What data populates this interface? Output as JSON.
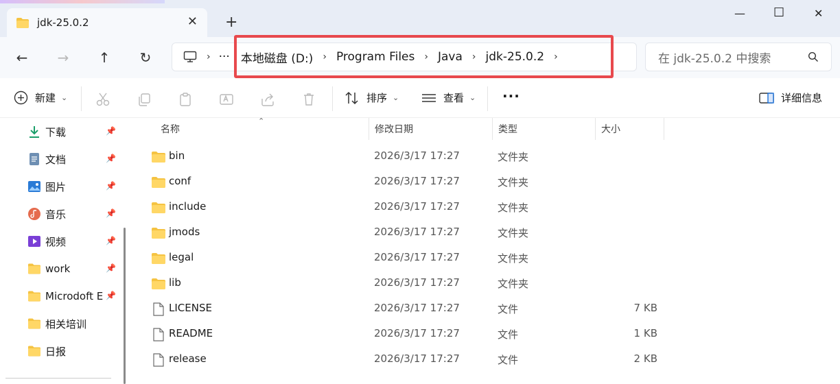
{
  "window": {
    "tab_title": "jdk-25.0.2",
    "close_tab": "✕",
    "new_tab": "+",
    "minimize": "—",
    "maximize": "☐",
    "close": "✕"
  },
  "nav": {
    "back": "←",
    "forward": "→",
    "up": "↑",
    "refresh": "↻",
    "overflow": "···",
    "breadcrumbs": [
      "本地磁盘 (D:)",
      "Program Files",
      "Java",
      "jdk-25.0.2"
    ],
    "search_placeholder": "在 jdk-25.0.2 中搜索"
  },
  "toolbar": {
    "new_label": "新建",
    "sort_label": "排序",
    "view_label": "查看",
    "more": "···",
    "details_label": "详细信息"
  },
  "sidebar": {
    "items": [
      {
        "label": "下载",
        "icon": "download-icon",
        "pinned": true
      },
      {
        "label": "文档",
        "icon": "document-icon",
        "pinned": true
      },
      {
        "label": "图片",
        "icon": "pictures-icon",
        "pinned": true
      },
      {
        "label": "音乐",
        "icon": "music-icon",
        "pinned": true
      },
      {
        "label": "视频",
        "icon": "video-icon",
        "pinned": true
      },
      {
        "label": "work",
        "icon": "folder-icon",
        "pinned": true
      },
      {
        "label": "Microdoft E",
        "icon": "folder-icon",
        "pinned": true
      },
      {
        "label": "相关培训",
        "icon": "folder-icon",
        "pinned": false
      },
      {
        "label": "日报",
        "icon": "folder-icon",
        "pinned": false
      }
    ]
  },
  "columns": {
    "name": "名称",
    "date": "修改日期",
    "type": "类型",
    "size": "大小"
  },
  "files": [
    {
      "name": "bin",
      "date": "2026/3/17 17:27",
      "type": "文件夹",
      "size": "",
      "kind": "folder"
    },
    {
      "name": "conf",
      "date": "2026/3/17 17:27",
      "type": "文件夹",
      "size": "",
      "kind": "folder"
    },
    {
      "name": "include",
      "date": "2026/3/17 17:27",
      "type": "文件夹",
      "size": "",
      "kind": "folder"
    },
    {
      "name": "jmods",
      "date": "2026/3/17 17:27",
      "type": "文件夹",
      "size": "",
      "kind": "folder"
    },
    {
      "name": "legal",
      "date": "2026/3/17 17:27",
      "type": "文件夹",
      "size": "",
      "kind": "folder"
    },
    {
      "name": "lib",
      "date": "2026/3/17 17:27",
      "type": "文件夹",
      "size": "",
      "kind": "folder"
    },
    {
      "name": "LICENSE",
      "date": "2026/3/17 17:27",
      "type": "文件",
      "size": "7 KB",
      "kind": "file"
    },
    {
      "name": "README",
      "date": "2026/3/17 17:27",
      "type": "文件",
      "size": "1 KB",
      "kind": "file"
    },
    {
      "name": "release",
      "date": "2026/3/17 17:27",
      "type": "文件",
      "size": "2 KB",
      "kind": "file"
    }
  ],
  "colors": {
    "highlight_border": "#e8494d",
    "folder_yellow": "#f5c342",
    "titlebar_bg": "#e8edf6"
  }
}
